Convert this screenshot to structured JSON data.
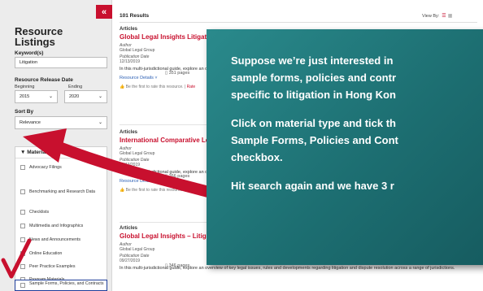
{
  "sidebar": {
    "collapse_glyph": "«",
    "title": "Resource Listings",
    "keyword_label": "Keyword(s)",
    "keyword_value": "Litigation",
    "date_label": "Resource Release Date",
    "beginning_label": "Beginning",
    "ending_label": "Ending",
    "beginning_value": "2015",
    "ending_value": "2020",
    "sort_label": "Sort By",
    "sort_value": "Relevance",
    "material_type_label": "▼ Material Type",
    "material_items": [
      "Advocacy Filings",
      "Benchmarking and Research Data",
      "Checklists",
      "Multimedia and Infographics",
      "News and Announcements",
      "Online Education",
      "Peer Practice Examples",
      "Program Materials",
      "Sample Forms, Policies, and Contracts"
    ]
  },
  "main": {
    "results_count": "101 Results",
    "view_by_label": "View By:",
    "articles": [
      {
        "type": "Articles",
        "title": "Global Legal Insights Litigation",
        "author_label": "Author",
        "author": "Global Legal Group",
        "pub_label": "Publication Date",
        "pub_date": "12/13/2019",
        "pages": "351 pages",
        "desc": "In this multi-jurisdictional guide, explore an overview of key legal issues, rules and developments regarding litigation and dispute resolution across a range of jurisdictions.",
        "details": "Resource Details ˅",
        "rate_text": "Be the first to rate this resource.",
        "rate_link": "Rate"
      },
      {
        "type": "Articles",
        "title": "International Comparative Legal Guide",
        "author_label": "Author",
        "author": "Global Legal Group",
        "pub_label": "Publication Date",
        "pub_date": "12/13/2019",
        "pages": "266 pages",
        "desc": "In this multi-jurisdictional guide, explore an overview of key legal issues across a range of jurisdictions.",
        "details": "Resource Details ˅",
        "rate_text": "Be the first to rate this resource.",
        "rate_link": "Rate"
      },
      {
        "type": "Articles",
        "title": "Global Legal Insights – Litigation",
        "author_label": "Author",
        "author": "Global Legal Group",
        "pub_label": "Publication Date",
        "pub_date": "09/27/2019",
        "pages": "346 pages",
        "desc": "In this multi-jurisdictional guide, explore an overview of key legal issues, rules and developments regarding litigation and dispute resolution across a range of jurisdictions."
      }
    ]
  },
  "callout": {
    "lines": [
      "Suppose we’re just interested in",
      "sample forms, policies and contr",
      "specific to litigation in Hong Kon",
      "Click on material type and tick th",
      "Sample Forms, Policies and Cont",
      "checkbox.",
      "Hit search again and we have 3 r"
    ]
  },
  "colors": {
    "brand_red": "#c8102e",
    "callout_teal": "#1d6f72",
    "highlight_blue": "#1f3f9a",
    "link_blue": "#2b5fb4"
  }
}
